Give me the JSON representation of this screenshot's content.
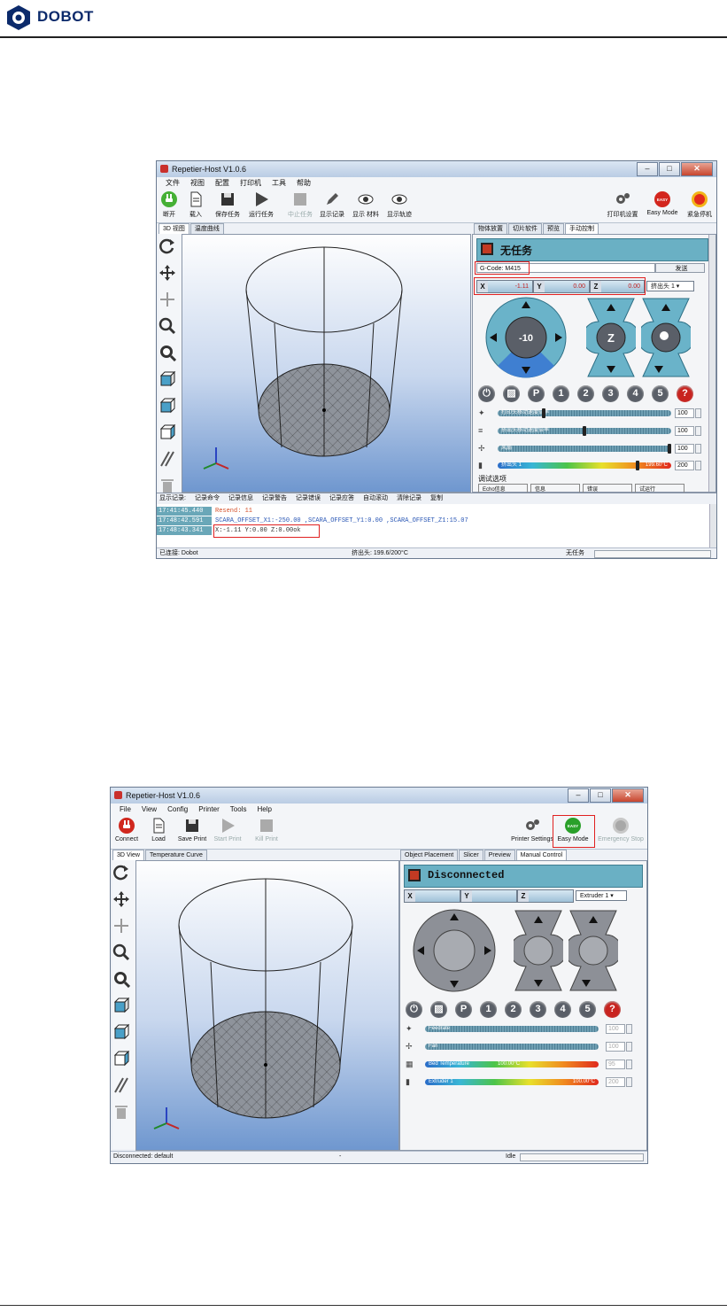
{
  "doc": {
    "brand": "DOBOT"
  },
  "win1": {
    "title": "Repetier-Host V1.0.6",
    "menu": [
      "文件",
      "视图",
      "配置",
      "打印机",
      "工具",
      "帮助"
    ],
    "toolbar": [
      "断开",
      "载入",
      "保存任务",
      "运行任务",
      "中止任务",
      "显示记录",
      "显示 材料",
      "显示轨迹"
    ],
    "toolbar_right": [
      "打印机设置",
      "Easy Mode",
      "紧急停机"
    ],
    "easy_badge": "EASY",
    "left_tabs": [
      "3D 视图",
      "温度曲线"
    ],
    "right_tabs": [
      "物体放置",
      "切片软件",
      "预览",
      "手动控制"
    ],
    "status": "无任务",
    "gcode_value": "G-Code: M415",
    "send_label": "发送",
    "axes": [
      {
        "l": "X",
        "v": "-1.11"
      },
      {
        "l": "Y",
        "v": "0.00"
      },
      {
        "l": "Z",
        "v": "0.00"
      }
    ],
    "extruder_select": "挤出头 1 ▾",
    "jog_center": "-10",
    "z_label": "Z",
    "icon_row": [
      "P",
      "1",
      "2",
      "3",
      "4",
      "5",
      "?"
    ],
    "sliders": [
      {
        "label": "打印头移动速度倍率",
        "value": "100"
      },
      {
        "label": "挤出头移动速度倍率",
        "value": "100"
      },
      {
        "label": "风扇",
        "value": "100"
      },
      {
        "label": "挤出头 1",
        "right": "199.60°C",
        "value": "200"
      }
    ],
    "debug_label": "调试选项",
    "debug_buttons": [
      "Echo信息",
      "信息",
      "错误",
      "试运行"
    ],
    "log_filters": [
      "显示记录:",
      "记录命令",
      "记录信息",
      "记录警告",
      "记录错误",
      "记录应答",
      "自动滚动",
      "清除记录",
      "复制"
    ],
    "log": [
      {
        "t": "17:41:45.440",
        "m": "Resend: 11"
      },
      {
        "t": "17:48:42.591",
        "m": "SCARA_OFFSET_X1:-250.00 ,SCARA_OFFSET_Y1:0.00 ,SCARA_OFFSET_Z1:15.07"
      },
      {
        "t": "17:48:43.341",
        "m": "X:-1.11 Y:0.00 Z:0.00ok"
      }
    ],
    "status_left": "已连接: Dobot",
    "status_mid": "挤出头: 199.6/200°C",
    "status_right": "无任务"
  },
  "win2": {
    "title": "Repetier-Host V1.0.6",
    "menu": [
      "File",
      "View",
      "Config",
      "Printer",
      "Tools",
      "Help"
    ],
    "toolbar": [
      "Connect",
      "Load",
      "Save Print",
      "Start Print",
      "Kill Print"
    ],
    "toolbar_right": [
      "Printer Settings",
      "Easy Mode",
      "Emergency Stop"
    ],
    "easy_badge": "EASY",
    "left_tabs": [
      "3D View",
      "Temperature Curve"
    ],
    "right_tabs": [
      "Object Placement",
      "Slicer",
      "Preview",
      "Manual Control"
    ],
    "status": "Disconnected",
    "axes": [
      {
        "l": "X",
        "v": ""
      },
      {
        "l": "Y",
        "v": ""
      },
      {
        "l": "Z",
        "v": ""
      }
    ],
    "extruder_select": "Extruder 1 ▾",
    "icon_row": [
      "P",
      "1",
      "2",
      "3",
      "4",
      "5",
      "?"
    ],
    "sliders": [
      {
        "label": "Feedrate",
        "value": "100"
      },
      {
        "label": "Fan",
        "value": "100"
      },
      {
        "label": "Bed Temperature",
        "mid": "100.00°C",
        "value": "95"
      },
      {
        "label": "Extruder 1",
        "right": "100.00°C",
        "value": "200"
      }
    ],
    "status_left": "Disconnected: default",
    "status_mid": "-",
    "status_right": "Idle"
  }
}
